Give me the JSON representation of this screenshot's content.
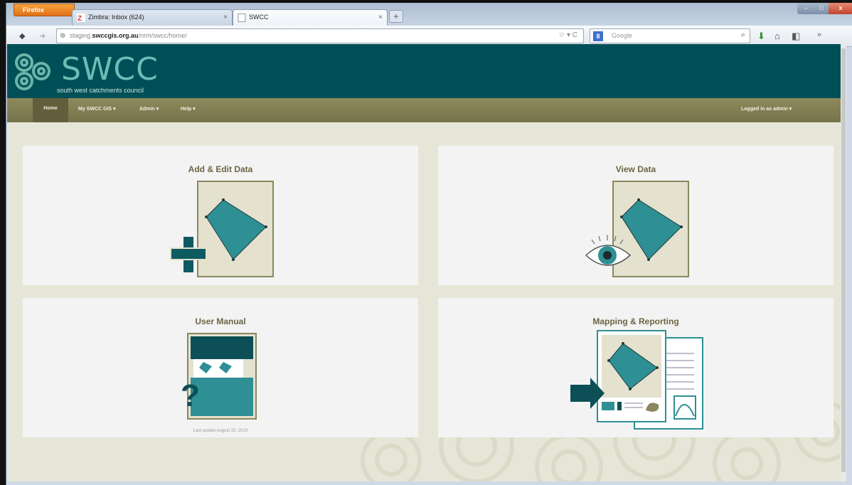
{
  "browser": {
    "app_button": "Firefox",
    "tabs": [
      {
        "label": "Zimbra: Inbox (624)",
        "icon": "zimbra-icon"
      },
      {
        "label": "SWCC",
        "icon": "page-icon"
      }
    ],
    "url_host_prefix": "staging.",
    "url_host": "swccgis.org.au",
    "url_path": "/nrm/swcc/home/",
    "search_placeholder": "Google",
    "url_right_controls": "☆ ▾ C"
  },
  "site": {
    "logo_text": "SWCC",
    "logo_subtitle": "south west catchments council",
    "colors": {
      "banner": "#004f57",
      "menubar": "#7f7b52",
      "accent": "#2b9a9b",
      "title": "#6b6544"
    }
  },
  "menu": {
    "home": "Home",
    "my_gis": "My SWCC GIS ▾",
    "admin": "Admin ▾",
    "help": "Help ▾",
    "user": "Logged in as admin ▾"
  },
  "tiles": {
    "add_edit": {
      "title": "Add & Edit Data"
    },
    "view": {
      "title": "View Data"
    },
    "manual": {
      "title": "User Manual",
      "note": "Last update August 22, 2013"
    },
    "mapping": {
      "title": "Mapping & Reporting"
    }
  }
}
